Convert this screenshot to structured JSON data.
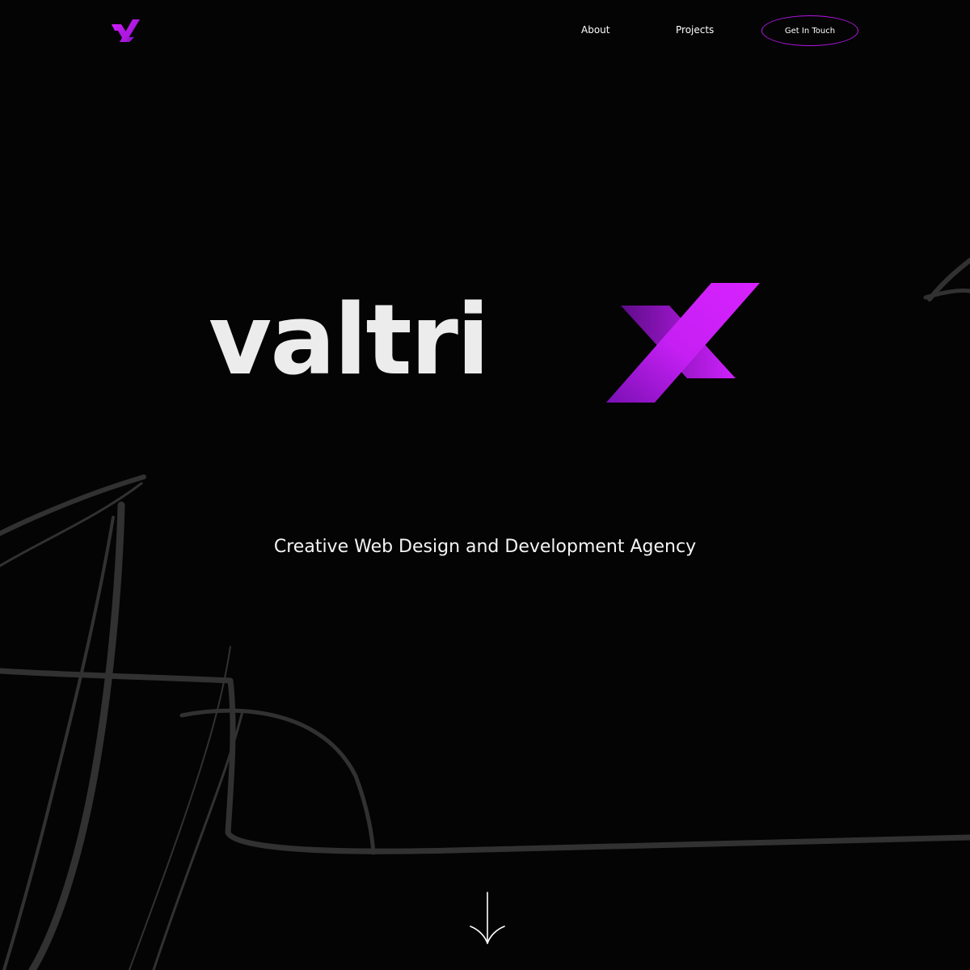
{
  "brand": {
    "name": "valtrix",
    "wordmark_main": "valtri",
    "wordmark_accent": "X",
    "accent_color": "#b516e6",
    "accent_color_dark": "#6e0fa0",
    "wordmark_color": "#ececec",
    "background_color": "#040404"
  },
  "nav": {
    "items": [
      {
        "label": "About"
      },
      {
        "label": "Projects"
      }
    ],
    "cta_label": "Get In Touch"
  },
  "hero": {
    "tagline": "Creative Web Design and Development Agency",
    "scroll_icon": "arrow-down-icon"
  }
}
